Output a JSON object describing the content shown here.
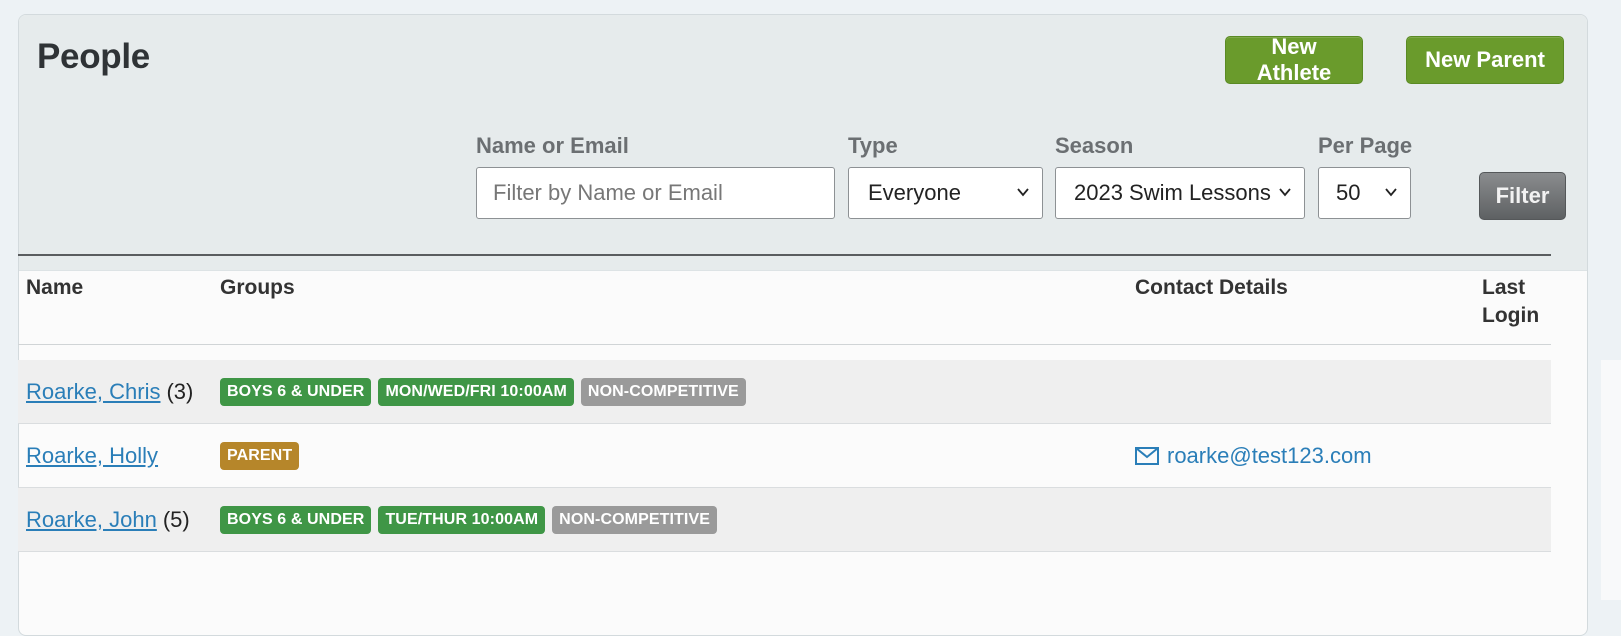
{
  "header": {
    "title": "People",
    "new_athlete_label": "New Athlete",
    "new_parent_label": "New Parent"
  },
  "filters": {
    "name_label": "Name or Email",
    "name_placeholder": "Filter by Name or Email",
    "name_value": "",
    "type_label": "Type",
    "type_value": "Everyone",
    "season_label": "Season",
    "season_value": "2023 Swim Lessons",
    "per_page_label": "Per Page",
    "per_page_value": "50",
    "filter_button_label": "Filter"
  },
  "table": {
    "columns": {
      "name": "Name",
      "groups": "Groups",
      "contact": "Contact Details",
      "last_login_line1": "Last",
      "last_login_line2": "Login"
    },
    "rows": [
      {
        "name": "Roarke, Chris",
        "count": "(3)",
        "groups": [
          {
            "label": "BOYS 6 & UNDER",
            "color": "green"
          },
          {
            "label": "MON/WED/FRI 10:00AM",
            "color": "green"
          },
          {
            "label": "NON-COMPETITIVE",
            "color": "gray"
          }
        ],
        "email": "",
        "last_login": ""
      },
      {
        "name": "Roarke, Holly",
        "count": "",
        "groups": [
          {
            "label": "PARENT",
            "color": "orange"
          }
        ],
        "email": "roarke@test123.com",
        "last_login": ""
      },
      {
        "name": "Roarke, John",
        "count": "(5)",
        "groups": [
          {
            "label": "BOYS 6 & UNDER",
            "color": "green"
          },
          {
            "label": "TUE/THUR 10:00AM",
            "color": "green"
          },
          {
            "label": "NON-COMPETITIVE",
            "color": "gray"
          }
        ],
        "email": "",
        "last_login": ""
      }
    ]
  },
  "colors": {
    "brand_green": "#6a9b2c",
    "tag_green": "#3f9646",
    "tag_gray": "#9a9a9a",
    "tag_orange": "#b6862a",
    "link_blue": "#2a7eb8"
  }
}
